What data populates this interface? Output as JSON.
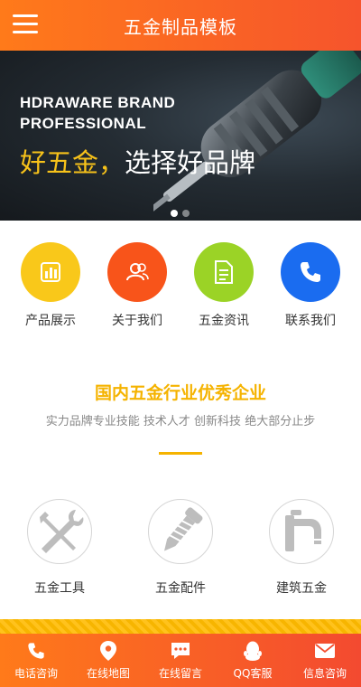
{
  "header": {
    "title": "五金制品模板"
  },
  "banner": {
    "en_line1": "HDRAWARE BRAND",
    "en_line2": "PROFESSIONAL",
    "cn_highlight": "好五金，",
    "cn_rest": "选择好品牌",
    "highlight_color": "#f7c21a",
    "slides": 2,
    "active_slide": 1
  },
  "quicknav": [
    {
      "label": "产品展示",
      "icon": "bar-chart-icon",
      "color": "#f9c81a"
    },
    {
      "label": "关于我们",
      "icon": "users-icon",
      "color": "#f8541a"
    },
    {
      "label": "五金资讯",
      "icon": "document-icon",
      "color": "#9bd326"
    },
    {
      "label": "联系我们",
      "icon": "phone-icon",
      "color": "#1a6cf0"
    }
  ],
  "section": {
    "title": "国内五金行业优秀企业",
    "subtitle": "实力品牌专业技能 技术人才 创新科技 绝大部分止步",
    "accent": "#f5b300"
  },
  "products": [
    {
      "label": "五金工具",
      "icon": "wrench-screwdriver-icon"
    },
    {
      "label": "五金配件",
      "icon": "screw-icon"
    },
    {
      "label": "建筑五金",
      "icon": "faucet-icon"
    }
  ],
  "footer": [
    {
      "label": "电话咨询",
      "icon": "phone-icon"
    },
    {
      "label": "在线地图",
      "icon": "map-pin-icon"
    },
    {
      "label": "在线留言",
      "icon": "chat-icon"
    },
    {
      "label": "QQ客服",
      "icon": "qq-icon"
    },
    {
      "label": "信息咨询",
      "icon": "mail-icon"
    }
  ]
}
